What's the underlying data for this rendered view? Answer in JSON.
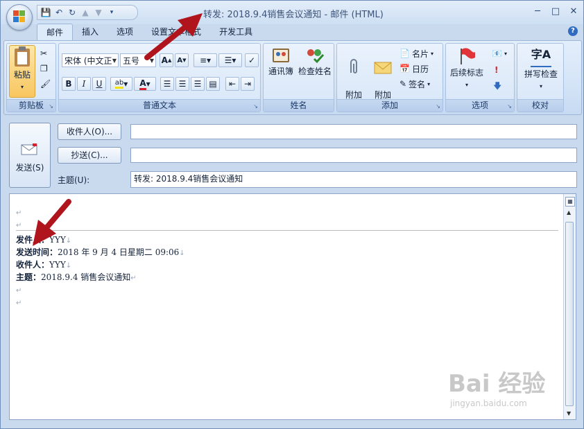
{
  "window": {
    "title": "转发: 2018.9.4销售会议通知 - 邮件 (HTML)"
  },
  "tabs": [
    "邮件",
    "插入",
    "选项",
    "设置文本格式",
    "开发工具"
  ],
  "ribbon": {
    "clipboard": {
      "label": "剪贴板",
      "paste": "粘贴"
    },
    "text": {
      "label": "普通文本",
      "font": "宋体 (中文正",
      "size": "五号"
    },
    "names": {
      "label": "姓名",
      "addressbook": "通讯簿",
      "checknames": "检查姓名"
    },
    "include": {
      "label": "添加",
      "attach_file": "附加\n文件",
      "attach_item": "附加\n项目",
      "card": "名片",
      "calendar": "日历",
      "signature": "签名"
    },
    "options": {
      "label": "选项",
      "followup": "后续标志"
    },
    "proofing": {
      "label": "校对",
      "spell": "拼写检查",
      "spell_icon_text": "字A"
    }
  },
  "header": {
    "send": "发送(S)",
    "to_button": "收件人(O)...",
    "cc_button": "抄送(C)...",
    "subject_label": "主题(U):",
    "to_value": "",
    "cc_value": "",
    "subject_value": "转发: 2018.9.4销售会议通知"
  },
  "body": {
    "lines": [
      {
        "k": "发件人：",
        "v": "YYY"
      },
      {
        "k": "发送时间：",
        "v": "2018 年 9 月 4 日星期二 09:06"
      },
      {
        "k": "收件人：",
        "v": "YYY"
      },
      {
        "k": "主题：",
        "v": "2018.9.4 销售会议通知"
      }
    ]
  },
  "watermark": {
    "main": "Bai 经验",
    "url": "jingyan.baidu.com"
  },
  "colors": {
    "accent": "#2f6bc1",
    "arrow": "#b0141c"
  }
}
